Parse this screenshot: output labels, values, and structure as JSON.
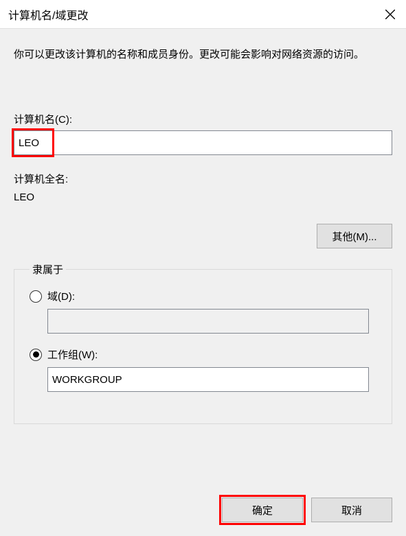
{
  "titlebar": {
    "title": "计算机名/域更改"
  },
  "description": "你可以更改该计算机的名称和成员身份。更改可能会影响对网络资源的访问。",
  "computer_name": {
    "label": "计算机名(C):",
    "value": "LEO"
  },
  "full_name": {
    "label": "计算机全名:",
    "value": "LEO"
  },
  "more_button": "其他(M)...",
  "membership": {
    "legend": "隶属于",
    "domain": {
      "label": "域(D):",
      "value": "",
      "selected": false
    },
    "workgroup": {
      "label": "工作组(W):",
      "value": "WORKGROUP",
      "selected": true
    }
  },
  "footer": {
    "ok": "确定",
    "cancel": "取消"
  }
}
